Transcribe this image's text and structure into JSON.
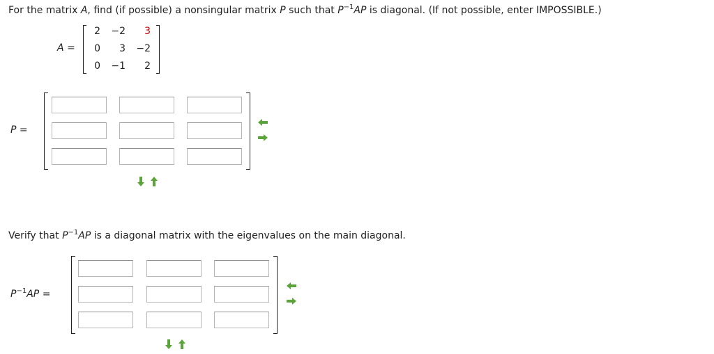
{
  "question": {
    "pre": "For the matrix ",
    "var_A": "A",
    "mid1": ", find (if possible) a nonsingular matrix ",
    "var_P": "P",
    "mid2": " such that ",
    "P_base": "P",
    "exp": "−1",
    "AP": "AP",
    "post": " is diagonal. (If not possible, enter IMPOSSIBLE.)"
  },
  "matrix_A": {
    "label": "A",
    "equals": "=",
    "rows": [
      [
        "2",
        "−2",
        "3"
      ],
      [
        "0",
        "3",
        "−2"
      ],
      [
        "0",
        "−1",
        "2"
      ]
    ],
    "highlight_color": "#cc0000"
  },
  "matrix_P": {
    "label": "P",
    "equals": "=",
    "inputs": [
      [
        "",
        "",
        ""
      ],
      [
        "",
        "",
        ""
      ],
      [
        "",
        "",
        ""
      ]
    ]
  },
  "verify": {
    "pre": "Verify that ",
    "P_base": "P",
    "exp": "−1",
    "AP": "AP",
    "post": " is a diagonal matrix with the eigenvalues on the main diagonal."
  },
  "matrix_D": {
    "label_base": "P",
    "label_exp": "−1",
    "label_rest": "AP",
    "equals": "=",
    "inputs": [
      [
        "",
        "",
        ""
      ],
      [
        "",
        "",
        ""
      ],
      [
        "",
        "",
        ""
      ]
    ]
  },
  "icons": {
    "row_controls": [
      "arrow-left-icon",
      "arrow-right-icon"
    ],
    "col_controls": [
      "arrow-down-icon",
      "arrow-up-icon"
    ],
    "arrow_color": "#5aa43a"
  }
}
